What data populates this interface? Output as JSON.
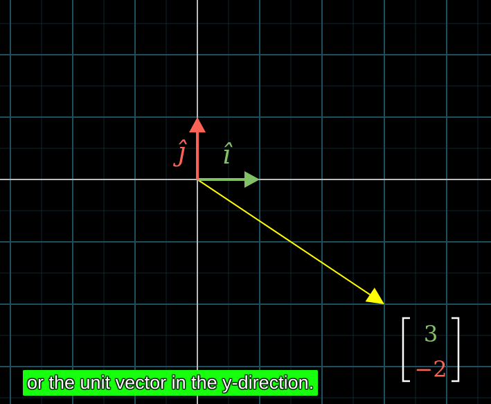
{
  "scene": {
    "grid_color": "#1f4f5f",
    "minor_grid_color": "#0f262e",
    "axis_color": "#bbbbbb",
    "i_hat": {
      "label": "î",
      "color": "#83c167",
      "vector": [
        1,
        0
      ]
    },
    "j_hat": {
      "label": "ĵ",
      "color": "#fc6255",
      "vector": [
        0,
        1
      ]
    },
    "v": {
      "color": "#ffff00",
      "vector": [
        3,
        -2
      ]
    },
    "matrix": {
      "top": "3",
      "bottom": "−2",
      "top_color": "#83c167",
      "bottom_color": "#fc6255",
      "bracket_color": "#ffffff"
    }
  },
  "caption": {
    "text": "or the unit vector in the y-direction.",
    "background": "#17ff0f"
  }
}
